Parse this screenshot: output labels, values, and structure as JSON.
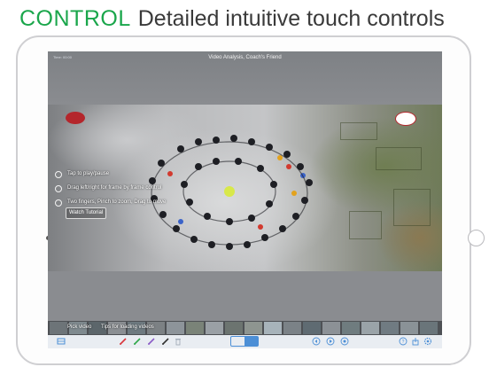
{
  "headline": {
    "keyword": "CONTROL",
    "rest": "Detailed intuitive touch controls"
  },
  "colors": {
    "keyword": "#1aa64b",
    "accent": "#4c8fd6",
    "pen_red": "#d9353c",
    "pen_green": "#2fa84a",
    "pen_purple": "#8b5cc7",
    "pen_black": "#333333"
  },
  "app": {
    "time": "Time: 00:00",
    "title": "Video Analysis, Coach's Friend"
  },
  "tips": [
    {
      "icon": "tap-icon",
      "text": "Tap to play/pause"
    },
    {
      "icon": "drag-icon",
      "text": "Drag left/right for frame by frame control"
    },
    {
      "icon": "two-finger-icon",
      "text": "Two fingers, Pinch to zoom, Drag to move"
    }
  ],
  "watch_tutorial": "Watch Tutorial",
  "filmstrip": {
    "pick_video": "Pick video",
    "tips": "Tips for loading videos"
  },
  "toolbar": {
    "left": [
      "library-icon"
    ],
    "pens": [
      "red-pen-icon",
      "green-pen-icon",
      "purple-pen-icon",
      "black-pen-icon",
      "trash-icon"
    ],
    "modes": [
      "draw-mode-icon",
      "move-mode-icon"
    ],
    "playback": [
      "skip-back-icon",
      "play-icon",
      "loop-icon"
    ],
    "right": [
      "help-icon",
      "share-icon",
      "settings-icon"
    ]
  }
}
